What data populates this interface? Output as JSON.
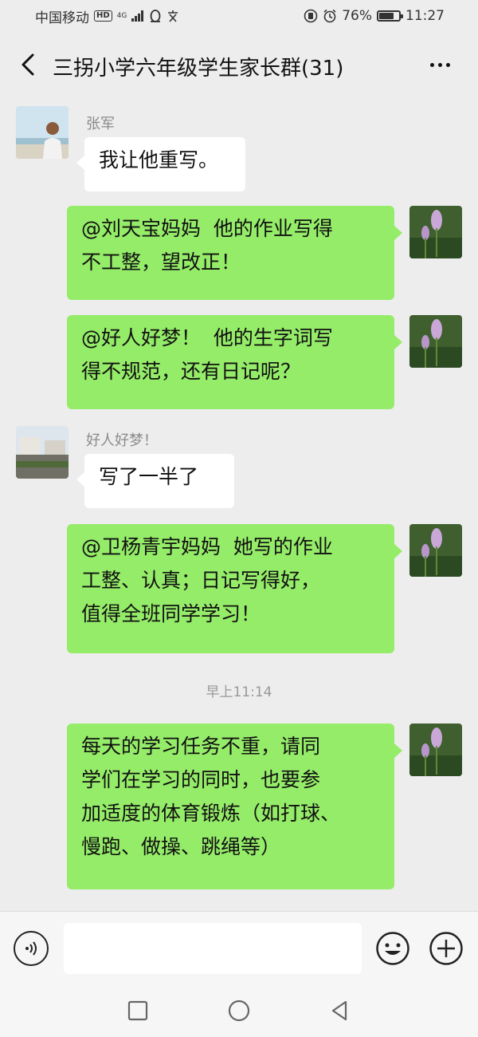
{
  "status_bar": {
    "carrier": "中国移动",
    "hd_badge": "HD",
    "network": "4G",
    "battery_percent": "76%",
    "battery_level": 0.76,
    "time": "11:27"
  },
  "header": {
    "title": "三拐小学六年级学生家长群(31)"
  },
  "messages": [
    {
      "direction": "incoming",
      "sender": "张军",
      "text": "我让他重写。"
    },
    {
      "direction": "outgoing",
      "text": "@刘天宝妈妈  他的作业写得\n不工整，望改正！"
    },
    {
      "direction": "outgoing",
      "text": "@好人好梦！  他的生字词写\n得不规范，还有日记呢？"
    },
    {
      "direction": "incoming",
      "sender": "好人好梦！",
      "text": "写了一半了"
    },
    {
      "direction": "outgoing",
      "text": "@卫杨青宇妈妈  她写的作业\n工整、认真；日记写得好，\n值得全班同学学习！"
    },
    {
      "direction": "timestamp",
      "text": "早上11:14"
    },
    {
      "direction": "outgoing",
      "text": "每天的学习任务不重，请同\n学们在学习的同时，也要参\n加适度的体育锻炼（如打球、\n慢跑、做操、跳绳等）"
    }
  ],
  "input_bar": {
    "voice_icon": "voice-icon",
    "emoji_icon": "emoji-icon",
    "plus_icon": "plus-icon",
    "placeholder": ""
  },
  "colors": {
    "outgoing_bubble": "#95ec69",
    "incoming_bubble": "#ffffff",
    "background": "#ededed"
  }
}
